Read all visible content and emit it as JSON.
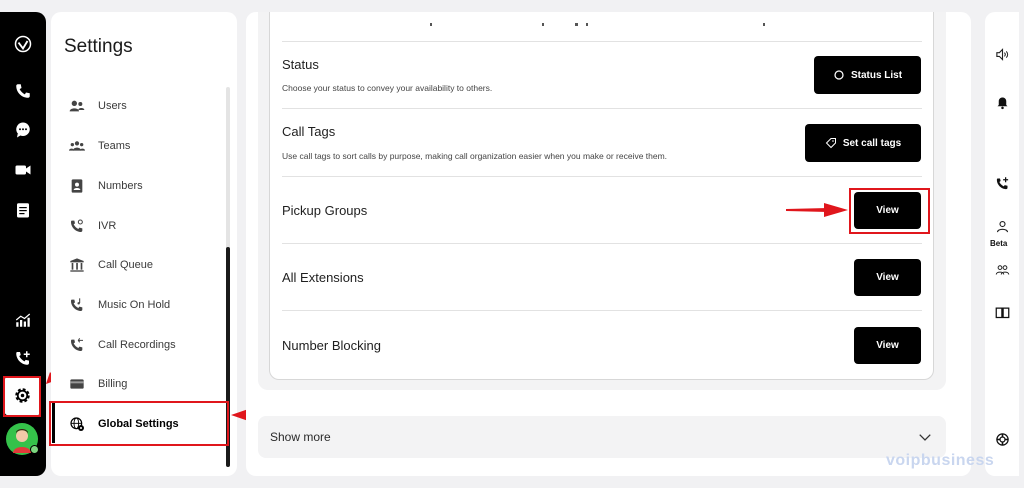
{
  "settings": {
    "title": "Settings",
    "nav": [
      {
        "label": "Users",
        "icon": "users-icon"
      },
      {
        "label": "Teams",
        "icon": "teams-icon"
      },
      {
        "label": "Numbers",
        "icon": "contact-book-icon"
      },
      {
        "label": "IVR",
        "icon": "ivr-phone-icon"
      },
      {
        "label": "Call Queue",
        "icon": "call-queue-icon"
      },
      {
        "label": "Music On Hold",
        "icon": "music-phone-icon"
      },
      {
        "label": "Call Recordings",
        "icon": "call-recordings-icon"
      },
      {
        "label": "Billing",
        "icon": "credit-card-icon"
      },
      {
        "label": "Global Settings",
        "icon": "globe-gear-icon"
      }
    ],
    "active": "Global Settings"
  },
  "rows": {
    "status": {
      "title": "Status",
      "desc": "Choose your status to convey your availability to others.",
      "button": "Status List"
    },
    "call_tags": {
      "title": "Call Tags",
      "desc": "Use call tags to sort calls by purpose, making call organization easier when you make or receive them.",
      "button": "Set call tags"
    },
    "pickup_groups": {
      "title": "Pickup Groups",
      "button": "View"
    },
    "all_extensions": {
      "title": "All Extensions",
      "button": "View"
    },
    "number_blocking": {
      "title": "Number Blocking",
      "button": "View"
    }
  },
  "show_more": "Show more",
  "right_rail": {
    "beta": "Beta"
  },
  "watermark": "voipbusiness",
  "colors": {
    "accent_red": "#e0161c",
    "button_black": "#000000",
    "avatar_green": "#35c24a"
  }
}
